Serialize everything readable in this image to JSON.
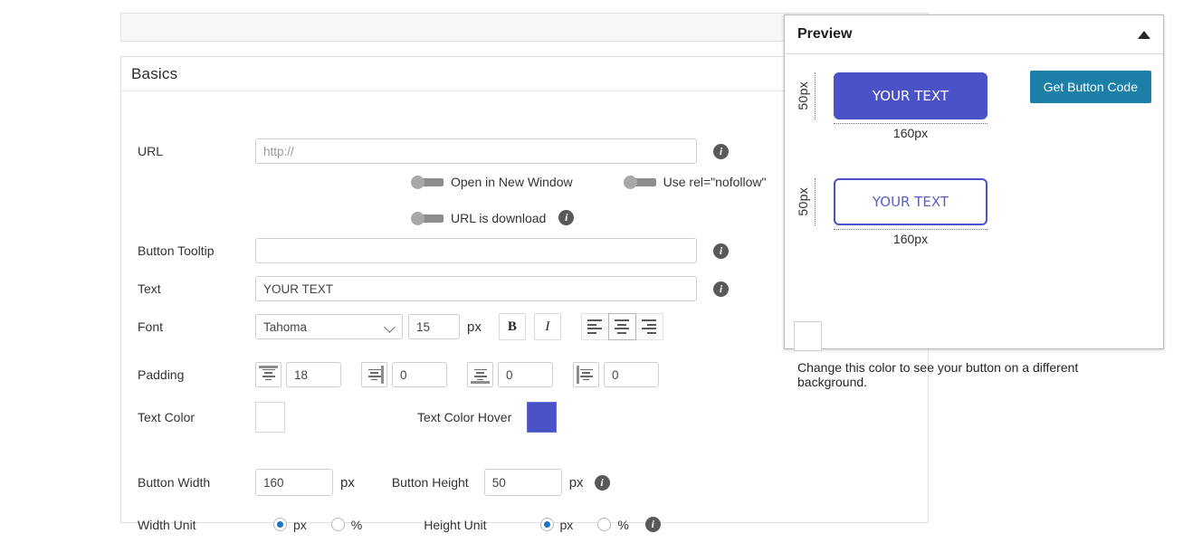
{
  "panel": {
    "title": "Basics",
    "rows": {
      "url": {
        "label": "URL",
        "value": "",
        "placeholder": "http://",
        "info_icon": "info-icon",
        "toggles": [
          {
            "label": "Open in New Window",
            "state": "off"
          },
          {
            "label": "Use rel=\"nofollow\"",
            "state": "off"
          },
          {
            "label": "URL is download",
            "state": "off",
            "info_icon": "info-icon"
          }
        ]
      },
      "tooltip": {
        "label": "Button Tooltip",
        "value": "",
        "placeholder": "",
        "info_icon": "info-icon"
      },
      "text": {
        "label": "Text",
        "value": "YOUR TEXT",
        "placeholder": "",
        "info_icon": "info-icon"
      },
      "font": {
        "label": "Font",
        "family": "Tahoma",
        "size": "15",
        "size_unit": "px",
        "bold_label": "B",
        "italic_label": "I",
        "alignments": [
          {
            "name": "align-left",
            "selected": false
          },
          {
            "name": "align-center",
            "selected": true
          },
          {
            "name": "align-right",
            "selected": false
          }
        ]
      },
      "padding": {
        "label": "Padding",
        "items": [
          {
            "edge": "top",
            "value": "18"
          },
          {
            "edge": "right",
            "value": "0"
          },
          {
            "edge": "bottom",
            "value": "0"
          },
          {
            "edge": "left",
            "value": "0"
          }
        ]
      },
      "text_color": {
        "label": "Text Color",
        "color": "#ffffff",
        "hover_label": "Text Color Hover",
        "hover_color": "#4b51c6"
      },
      "button_width": {
        "label": "Button Width",
        "value": "160",
        "unit": "px"
      },
      "button_height": {
        "label": "Button Height",
        "value": "50",
        "unit": "px",
        "info_icon": "info-icon"
      },
      "width_unit": {
        "label": "Width Unit",
        "options": [
          {
            "label": "px",
            "selected": true
          },
          {
            "label": "%",
            "selected": false
          }
        ]
      },
      "height_unit": {
        "label": "Height Unit",
        "options": [
          {
            "label": "px",
            "selected": true
          },
          {
            "label": "%",
            "selected": false
          }
        ],
        "info_icon": "info-icon"
      }
    }
  },
  "preview": {
    "title": "Preview",
    "collapse_icon": "collapse-up-caret-icon",
    "code_button": "Get Button Code",
    "code_button_color": "#1b7fa8",
    "buttons": [
      {
        "text": "YOUR TEXT",
        "style": "filled",
        "fill": "#4b51c6",
        "text_color": "#ffffff",
        "height_label": "50px",
        "width_label": "160px"
      },
      {
        "text": "YOUR TEXT",
        "style": "outline",
        "fill": "#ffffff",
        "border_color": "#4b51c6",
        "text_color": "#5a60c9",
        "height_label": "50px",
        "width_label": "160px"
      }
    ],
    "background_swatch_color": "#ffffff",
    "background_note": "Change this color to see your button on a different background."
  }
}
